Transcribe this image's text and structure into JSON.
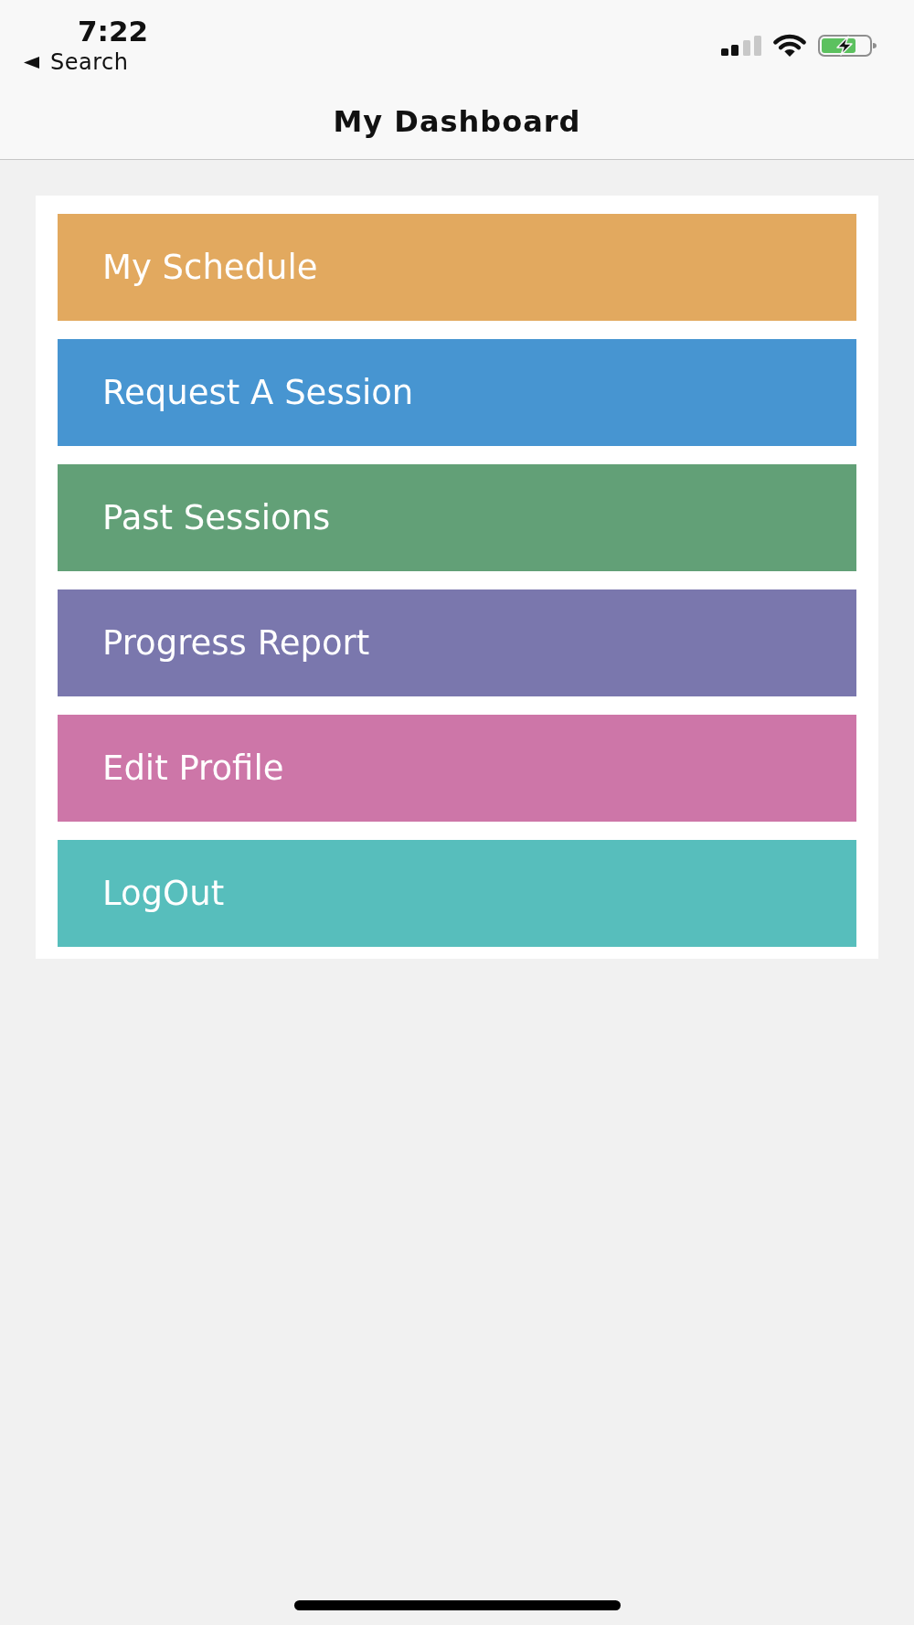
{
  "status_bar": {
    "time": "7:22",
    "back_label": "Search"
  },
  "nav_bar": {
    "title": "My Dashboard"
  },
  "menu": {
    "items": [
      {
        "label": "My Schedule",
        "color": "#e2a95f"
      },
      {
        "label": "Request A Session",
        "color": "#4795d1"
      },
      {
        "label": "Past Sessions",
        "color": "#62a077"
      },
      {
        "label": "Progress Report",
        "color": "#7a77ad"
      },
      {
        "label": "Edit Profile",
        "color": "#cd76a8"
      },
      {
        "label": "LogOut",
        "color": "#57bebc"
      }
    ]
  }
}
